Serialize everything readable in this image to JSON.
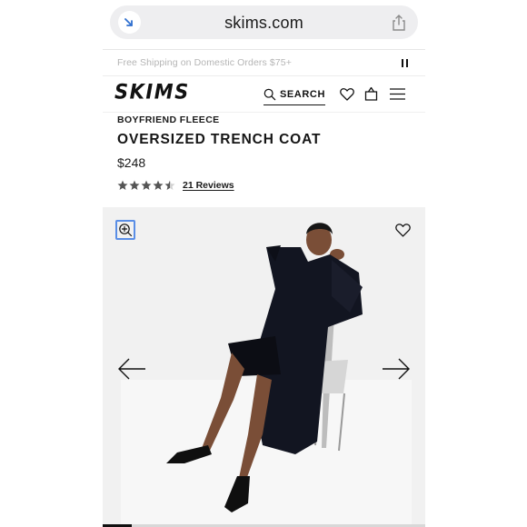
{
  "browser": {
    "url": "skims.com",
    "reader_icon": "reader-mode-icon",
    "share_icon": "share-icon"
  },
  "promo": {
    "text": "Free Shipping on Domestic Orders $75+",
    "pause_icon": "pause-icon"
  },
  "nav": {
    "logo": "SKIMS",
    "search_label": "SEARCH",
    "icons": [
      "search-icon",
      "heart-icon",
      "bag-icon",
      "menu-icon"
    ]
  },
  "product": {
    "collection": "BOYFRIEND FLEECE",
    "title": "OVERSIZED TRENCH COAT",
    "price": "$248",
    "rating": 4.5,
    "rating_max": 5,
    "reviews_label": "21 Reviews"
  },
  "gallery": {
    "icons": [
      "zoom-in-icon",
      "wishlist-heart-icon",
      "arrow-left-icon",
      "arrow-right-icon"
    ],
    "image_progress": 0.09
  },
  "colors": {
    "accent": "#111111",
    "focus_ring": "#5a8ee6",
    "promo_text": "#b5b5b5",
    "url_bar": "#eeeef0"
  }
}
